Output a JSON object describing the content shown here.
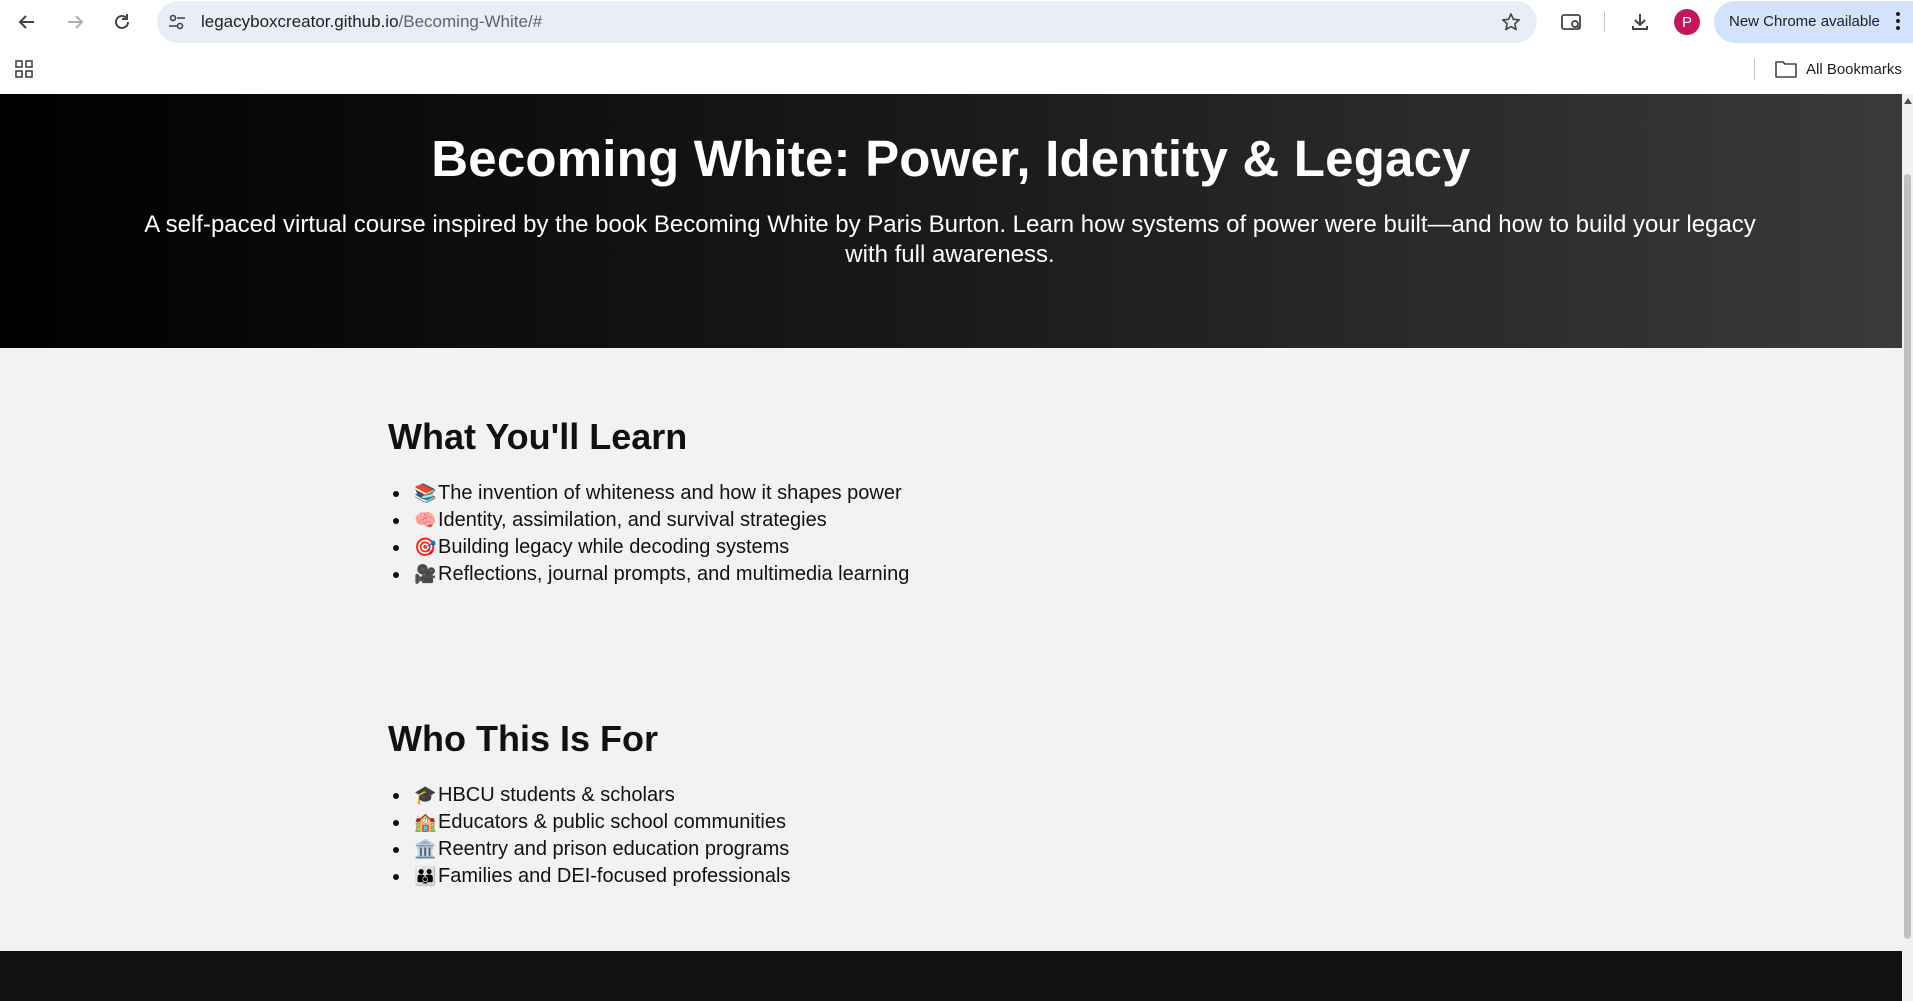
{
  "browser": {
    "url_host": "legacyboxcreator.github.io",
    "url_path": "/Becoming-White/#",
    "avatar_letter": "P",
    "update_label": "New Chrome available",
    "all_bookmarks_label": "All Bookmarks"
  },
  "hero": {
    "title": "Becoming White: Power, Identity & Legacy",
    "subtitle": "A self-paced virtual course inspired by the book Becoming White by Paris Burton. Learn how systems of power were built—and how to build your legacy with full awareness."
  },
  "learn": {
    "heading": "What You'll Learn",
    "items": [
      {
        "emoji": "📚",
        "text": "The invention of whiteness and how it shapes power"
      },
      {
        "emoji": "🧠",
        "text": "Identity, assimilation, and survival strategies"
      },
      {
        "emoji": "🎯",
        "text": "Building legacy while decoding systems"
      },
      {
        "emoji": "🎥",
        "text": "Reflections, journal prompts, and multimedia learning"
      }
    ]
  },
  "audience": {
    "heading": "Who This Is For",
    "items": [
      {
        "emoji": "🎓",
        "text": "HBCU students & scholars"
      },
      {
        "emoji": "🏫",
        "text": "Educators & public school communities"
      },
      {
        "emoji": "🏛️",
        "text": "Reentry and prison education programs"
      },
      {
        "emoji": "👪",
        "text": "Families and DEI-focused professionals"
      }
    ]
  }
}
